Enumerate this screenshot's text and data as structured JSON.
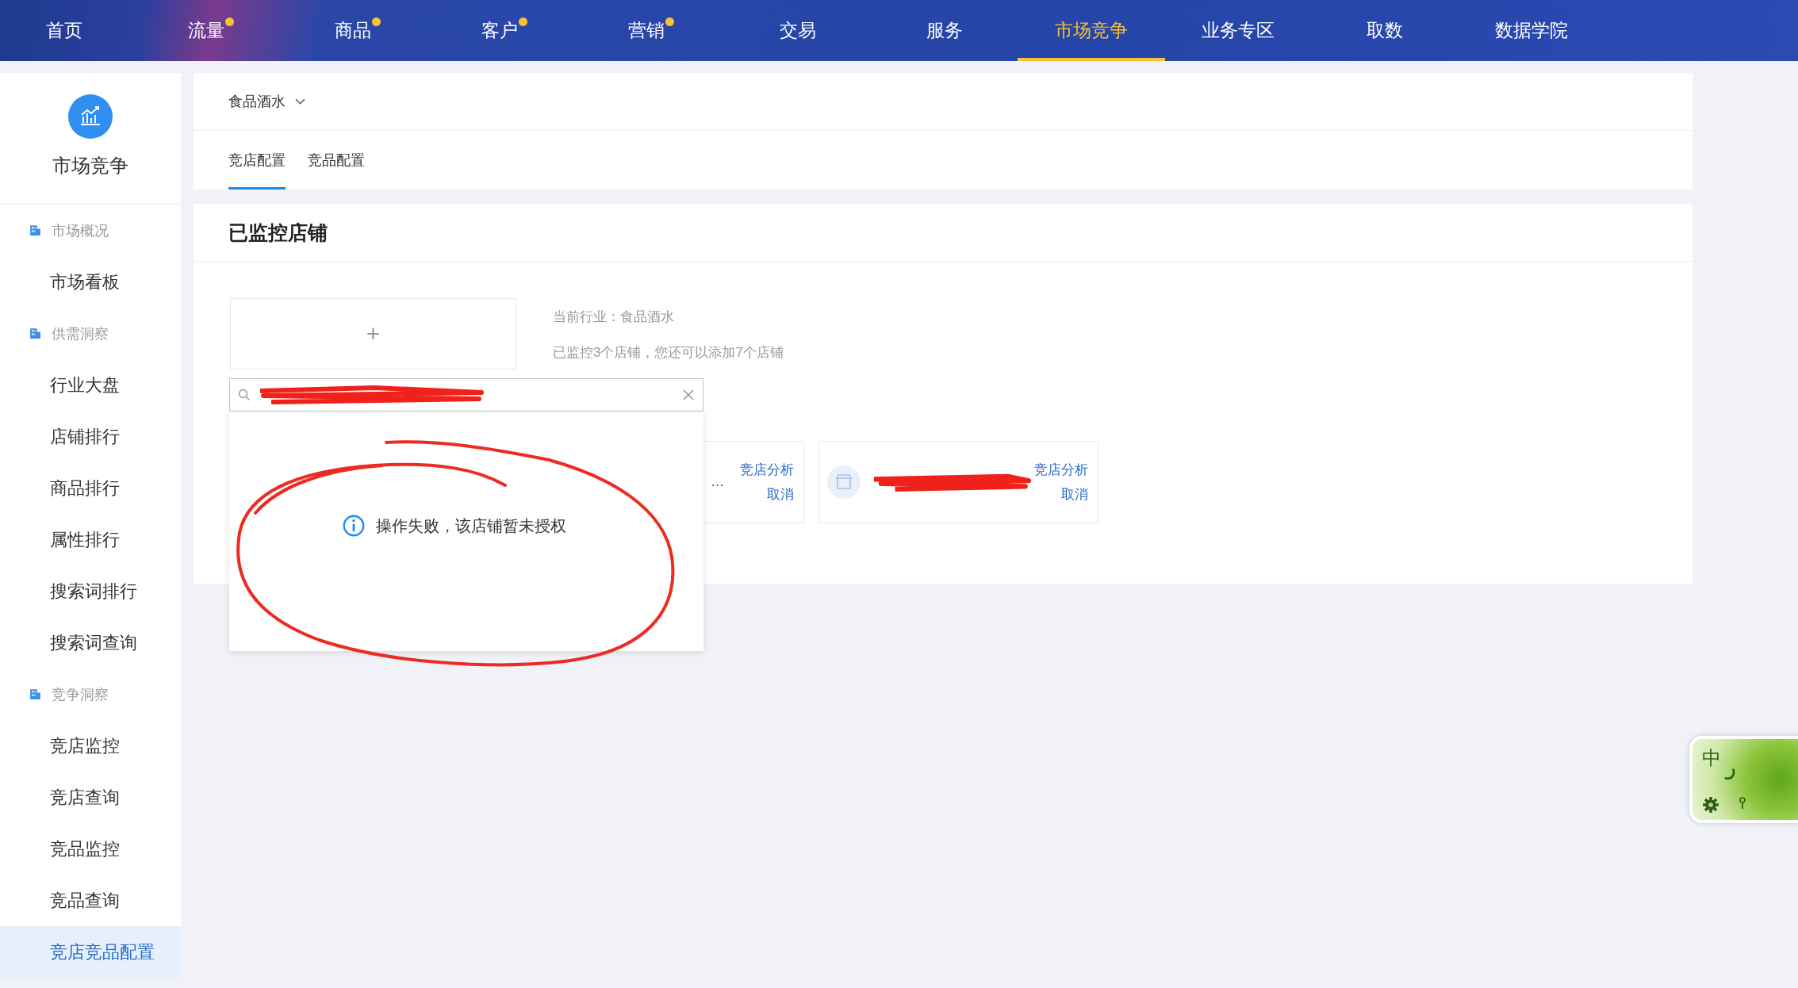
{
  "top_nav": [
    {
      "label": "首页",
      "dot": false,
      "selected": false
    },
    {
      "label": "流量",
      "dot": true,
      "selected": false
    },
    {
      "label": "商品",
      "dot": true,
      "selected": false
    },
    {
      "label": "客户",
      "dot": true,
      "selected": false
    },
    {
      "label": "营销",
      "dot": true,
      "selected": false
    },
    {
      "label": "交易",
      "dot": false,
      "selected": false
    },
    {
      "label": "服务",
      "dot": false,
      "selected": false
    },
    {
      "label": "市场竞争",
      "dot": false,
      "selected": true
    },
    {
      "label": "业务专区",
      "dot": false,
      "selected": false
    },
    {
      "label": "取数",
      "dot": false,
      "selected": false
    },
    {
      "label": "数据学院",
      "dot": false,
      "selected": false
    }
  ],
  "sidebar": {
    "title": "市场竞争",
    "groups": [
      {
        "label": "市场概况",
        "items": [
          {
            "label": "市场看板",
            "selected": false
          }
        ]
      },
      {
        "label": "供需洞察",
        "items": [
          {
            "label": "行业大盘",
            "selected": false
          },
          {
            "label": "店铺排行",
            "selected": false
          },
          {
            "label": "商品排行",
            "selected": false
          },
          {
            "label": "属性排行",
            "selected": false
          },
          {
            "label": "搜索词排行",
            "selected": false
          },
          {
            "label": "搜索词查询",
            "selected": false
          }
        ]
      },
      {
        "label": "竞争洞察",
        "items": [
          {
            "label": "竞店监控",
            "selected": false
          },
          {
            "label": "竞店查询",
            "selected": false
          },
          {
            "label": "竞品监控",
            "selected": false
          },
          {
            "label": "竞品查询",
            "selected": false
          },
          {
            "label": "竞店竞品配置",
            "selected": true
          }
        ]
      }
    ]
  },
  "industry_select": {
    "value": "食品酒水"
  },
  "tabs": [
    {
      "label": "竞店配置",
      "selected": true
    },
    {
      "label": "竞品配置",
      "selected": false
    }
  ],
  "monitored": {
    "title": "已监控店铺",
    "add_button": {
      "label": "+"
    },
    "info": [
      "当前行业：食品酒水",
      "已监控3个店铺，您还可以添加7个店铺"
    ],
    "stores": [
      {
        "redacted": false,
        "name": "…",
        "actions": [
          "竞店分析",
          "取消"
        ]
      },
      {
        "redacted": true,
        "actions": [
          "竞店分析",
          "取消"
        ]
      }
    ]
  },
  "search": {
    "redacted": true,
    "message": "操作失败，该店铺暂未授权"
  },
  "annotation": {
    "circled": true
  },
  "ime_toolbar": {
    "mode": "中"
  }
}
